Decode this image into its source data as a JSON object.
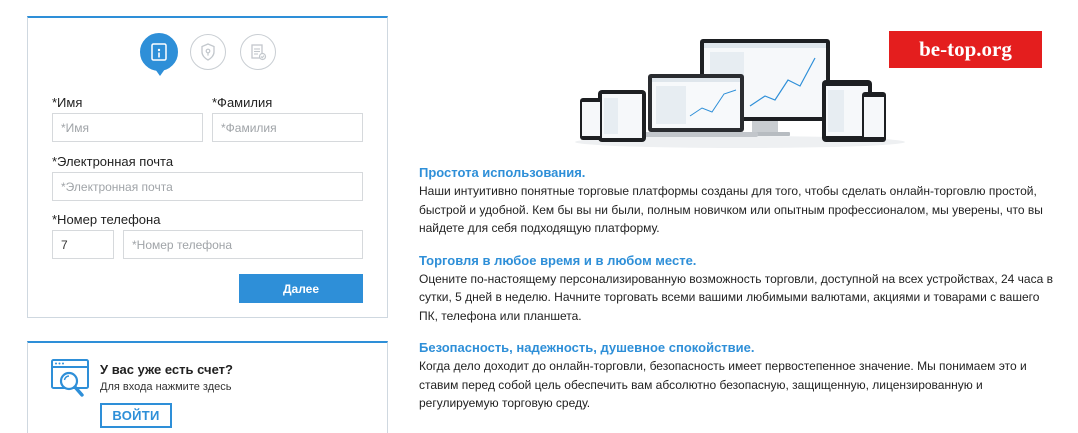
{
  "registration": {
    "steps": [
      {
        "icon": "id-card-icon",
        "active": true
      },
      {
        "icon": "shield-lock-icon",
        "active": false
      },
      {
        "icon": "document-check-icon",
        "active": false
      }
    ],
    "first_name": {
      "label": "*Имя",
      "placeholder": "*Имя"
    },
    "last_name": {
      "label": "*Фамилия",
      "placeholder": "*Фамилия"
    },
    "email": {
      "label": "*Электронная почта",
      "placeholder": "*Электронная почта"
    },
    "phone": {
      "label": "*Номер телефона",
      "code_value": "7",
      "placeholder": "*Номер телефона"
    },
    "next_label": "Далее"
  },
  "login": {
    "icon": "browser-search-icon",
    "title": "У вас уже есть счет?",
    "subtitle": "Для входа нажмите здесь",
    "button_label": "ВОЙТИ"
  },
  "watermark": "be-top.org",
  "features": [
    {
      "title": "Простота использования.",
      "body": "Наши интуитивно понятные торговые платформы созданы для того, чтобы сделать онлайн-торговлю простой, быстрой и удобной. Кем бы вы ни были, полным новичком или опытным профессионалом, мы уверены, что вы найдете для себя подходящую платформу."
    },
    {
      "title": "Торговля в любое время и в любом месте.",
      "body": "Оцените по-настоящему персонализированную возможность торговли, доступной на всех устройствах, 24 часа в сутки, 5 дней в неделю. Начните торговать всеми вашими любимыми валютами, акциями и товарами с вашего ПК, телефона или планшета."
    },
    {
      "title": "Безопасность, надежность, душевное спокойствие.",
      "body": "Когда дело доходит до онлайн-торговли, безопасность имеет первостепенное значение. Мы понимаем это и ставим перед собой цель обеспечить вам абсолютно безопасную, защищенную, лицензированную и регулируемую торговую среду."
    }
  ],
  "colors": {
    "accent": "#2e8fd8",
    "watermark_bg": "#e41e1e"
  }
}
